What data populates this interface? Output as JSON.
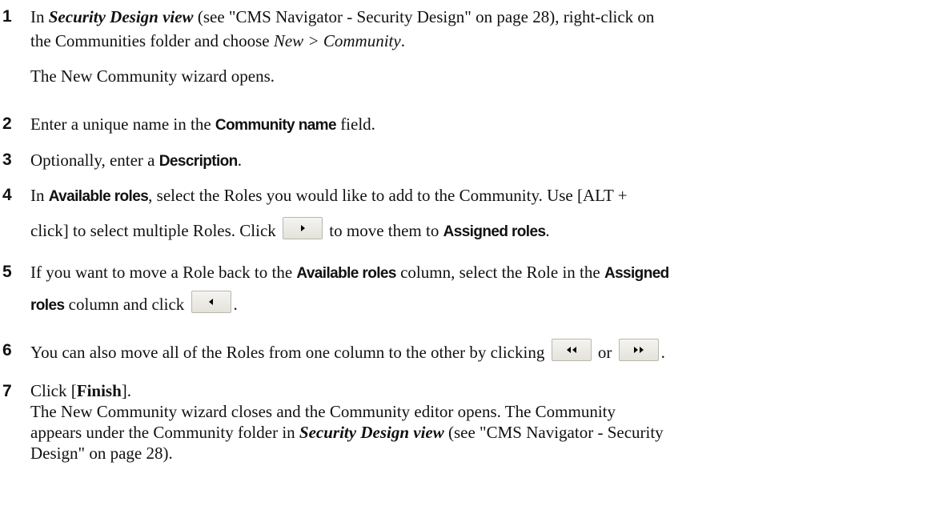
{
  "steps": [
    {
      "num": "1",
      "a_pre": "In ",
      "a_view": "Security Design view",
      "a_ref": " (see \"CMS Navigator - Security Design\" on page 28), right-click on",
      "b_pre": "the Communities folder and choose ",
      "b_menu": "New > Community",
      "b_post": ".",
      "note": "The New Community wizard opens."
    },
    {
      "num": "2",
      "pre": "Enter a unique name in the ",
      "field": "Community name",
      "post": " field."
    },
    {
      "num": "3",
      "pre": "Optionally, enter a ",
      "field": "Description",
      "post": "."
    },
    {
      "num": "4",
      "a_pre": "In ",
      "a_field": "Available roles",
      "a_post": ", select the Roles you would like to add to the Community. Use [ALT +",
      "b_pre": "click] to select multiple Roles. Click ",
      "b_mid": " to move them to ",
      "b_field": "Assigned roles",
      "b_post": ".",
      "button_icon": "move-right-icon"
    },
    {
      "num": "5",
      "a_pre": "If you want to move a Role back to the ",
      "a_field1": "Available roles",
      "a_mid": " column, select the Role in the ",
      "a_field2": "Assigned",
      "b_field": "roles",
      "b_mid": " column and click ",
      "b_post": ".",
      "button_icon": "move-left-icon"
    },
    {
      "num": "6",
      "pre": "You can also move all of the Roles from one column to the other by clicking ",
      "or": " or ",
      "post": ".",
      "button_icons": [
        "move-all-left-icon",
        "move-all-right-icon"
      ]
    },
    {
      "num": "7",
      "a_pre": "Click [",
      "a_button": "Finish",
      "a_post": "].",
      "l2": "The New Community wizard closes and the Community editor opens. The Community",
      "l3_pre": "appears under the Community folder in ",
      "l3_view": "Security Design view",
      "l3_post": " (see \"CMS Navigator - Security",
      "l4": "Design\" on page 28)."
    }
  ]
}
